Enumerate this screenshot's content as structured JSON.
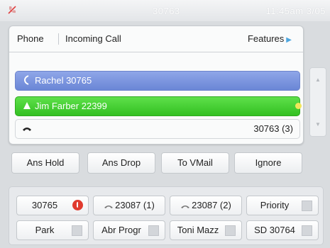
{
  "status": {
    "extension": "30763",
    "clock": "11:45am 3/05",
    "mute_icon": "mute-icon",
    "accent": "#e04040"
  },
  "header": {
    "app": "Phone",
    "title": "Incoming Call",
    "features": "Features"
  },
  "calls": {
    "rachel": "Rachel 30765",
    "jim": "Jim Farber 22399",
    "active_number": "30763 (3)"
  },
  "softkeys": [
    "Ans Hold",
    "Ans Drop",
    "To VMail",
    "Ignore"
  ],
  "line_keys": [
    {
      "label": "30765",
      "indicator": "red"
    },
    {
      "label": "23087 (1)",
      "indicator": "handset"
    },
    {
      "label": "23087 (2)",
      "indicator": "handset"
    },
    {
      "label": "Priority",
      "indicator": "square"
    },
    {
      "label": "Park",
      "indicator": "square"
    },
    {
      "label": "Abr Progr",
      "indicator": "square"
    },
    {
      "label": "Toni Mazz",
      "indicator": "square"
    },
    {
      "label": "SD 30764",
      "indicator": "square"
    }
  ],
  "colors": {
    "rachel_bg": "#7a93dc",
    "jim_bg": "#3fcc2c",
    "alert_red": "#e03a2e"
  }
}
